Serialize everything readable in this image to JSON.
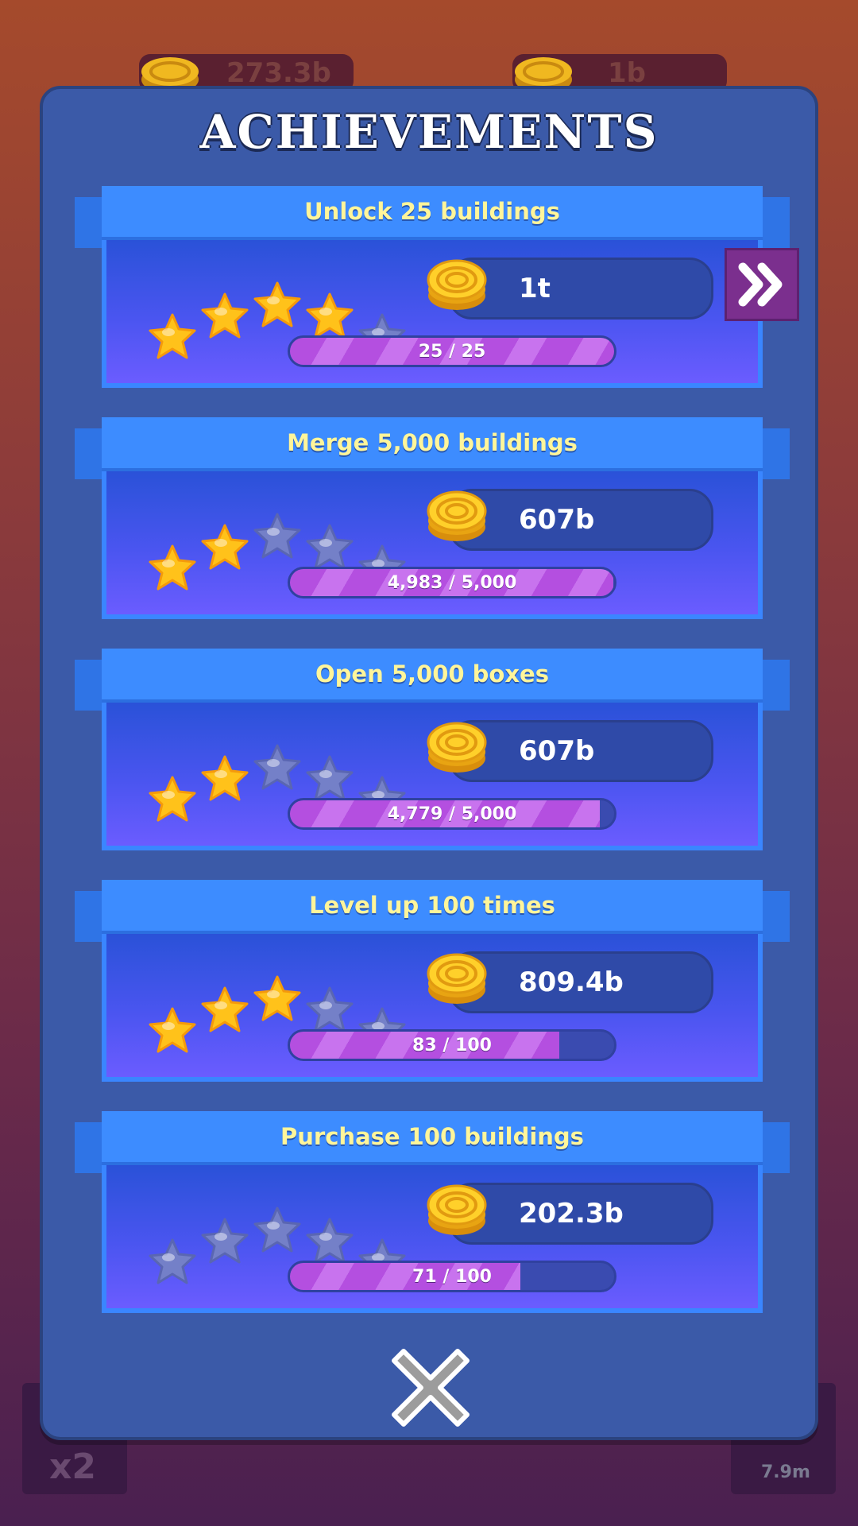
{
  "background": {
    "coins_left": "273.3b",
    "coins_right": "1b",
    "tile_label_left": "x2",
    "tile_label_right": "7.9m"
  },
  "title": "ACHIEVEMENTS",
  "achievements": [
    {
      "title": "Unlock 25 buildings",
      "stars": 4,
      "reward": "1t",
      "progress_text": "25 / 25",
      "progress": 1.0,
      "claimable": true
    },
    {
      "title": "Merge 5,000 buildings",
      "stars": 2,
      "reward": "607b",
      "progress_text": "4,983 / 5,000",
      "progress": 0.997,
      "claimable": false
    },
    {
      "title": "Open 5,000 boxes",
      "stars": 2,
      "reward": "607b",
      "progress_text": "4,779 / 5,000",
      "progress": 0.956,
      "claimable": false
    },
    {
      "title": "Level up 100 times",
      "stars": 3,
      "reward": "809.4b",
      "progress_text": "83 / 100",
      "progress": 0.83,
      "claimable": false
    },
    {
      "title": "Purchase 100 buildings",
      "stars": 0,
      "reward": "202.3b",
      "progress_text": "71 / 100",
      "progress": 0.71,
      "claimable": false
    }
  ],
  "icons": {
    "star_filled": "star-icon",
    "star_empty": "star-outline-icon",
    "coin": "coin-icon",
    "claim": "double-chevron-right-icon",
    "close": "close-icon"
  },
  "colors": {
    "modal_bg": "#3b5aa8",
    "ribbon": "#3d8cff",
    "ribbon_text": "#fff59a",
    "star_gold": "#ffc21a",
    "star_empty": "#7480c8",
    "progress_fill": "#b44fe0",
    "claim_button": "#7b2f8e"
  }
}
